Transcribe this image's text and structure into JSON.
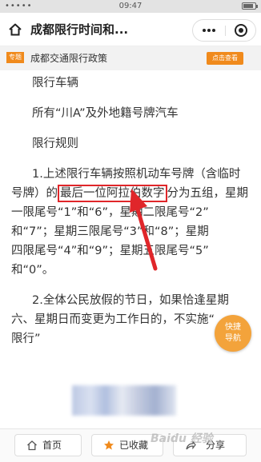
{
  "status_bar": {
    "left": "•••••",
    "time": "09:47"
  },
  "header": {
    "title": "成都限行时间和...",
    "home_icon": "home-icon",
    "more_icon": "more-dots-icon",
    "close_icon": "close-target-icon"
  },
  "topic": {
    "badge": "专题",
    "title": "成都交通限行政策",
    "button": "点击查看"
  },
  "article": {
    "p1": "限行车辆",
    "p2": "所有“川A”及外地籍号牌汽车",
    "p3": "限行规则",
    "p4_l1": "1.上述限行车辆按照机动车号牌（含临时",
    "p4_l2_pre": "号牌）的",
    "p4_l2_hl": "最后一位阿拉伯数字",
    "p4_l2_post": "分为五组，星期",
    "p4_l3": "一限尾号“1”和“6”，星期二限尾号“2”",
    "p4_l4": "和“7”；星期三限尾号“3”和“8”；星期",
    "p4_l5": "四限尾号“4”和“9”；星期五限尾号“5”",
    "p4_l6": "和“0”。",
    "p5_l1": "2.全体公民放假的节日，如果恰逢星期",
    "p5_l2": "六、星期日而变更为工作日的，不实施“",
    "p5_l3": "限行”",
    "highlight_color": "#e0262a"
  },
  "float_nav": {
    "line1": "快捷",
    "line2": "导航",
    "color": "#f3a33b"
  },
  "bottom_bar": {
    "home_label": "首页",
    "home_icon": "home-outline-icon",
    "fav_label": "已收藏",
    "fav_icon": "star-icon",
    "share_label": "分享",
    "share_icon": "share-icon",
    "watermark": "Baidu 经验"
  },
  "colors": {
    "accent": "#f08a1c",
    "star": "#f08a1c"
  }
}
